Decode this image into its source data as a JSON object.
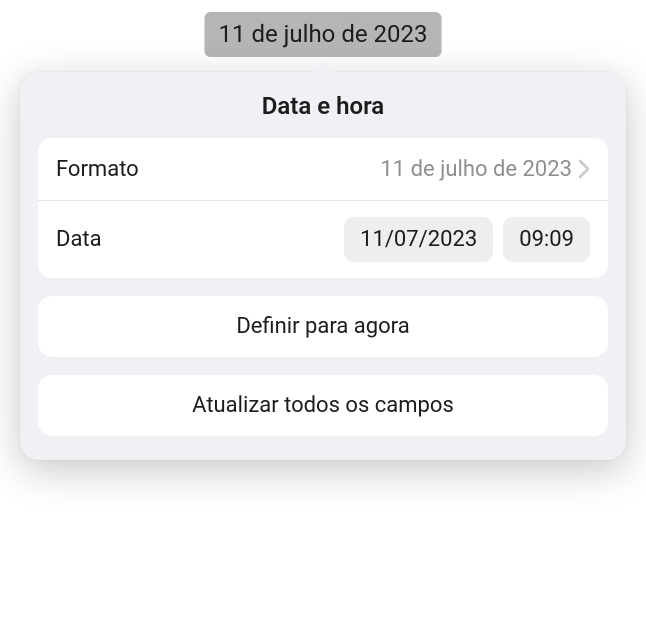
{
  "token": {
    "text": "11 de julho de 2023"
  },
  "popover": {
    "title": "Data e hora",
    "format": {
      "label": "Formato",
      "value": "11 de julho de 2023"
    },
    "date": {
      "label": "Data",
      "date_value": "11/07/2023",
      "time_value": "09:09"
    },
    "set_now_label": "Definir para agora",
    "update_all_label": "Atualizar todos os campos"
  }
}
